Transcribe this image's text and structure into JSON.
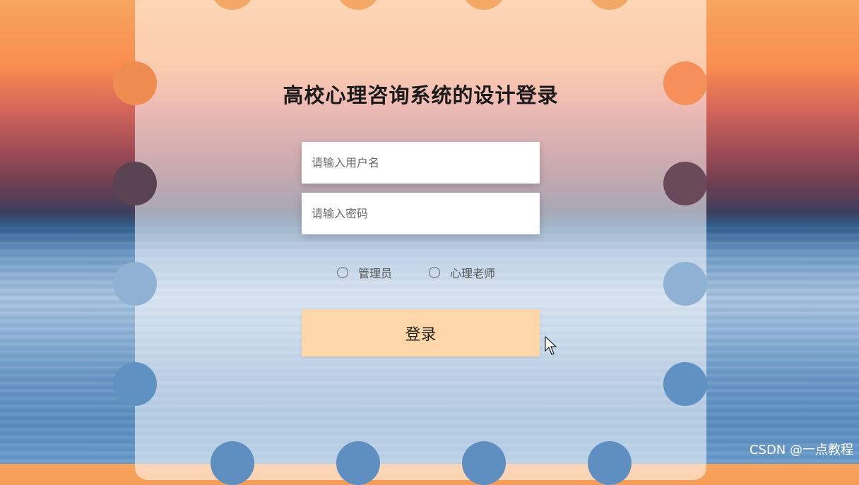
{
  "login": {
    "title": "高校心理咨询系统的设计登录",
    "username_placeholder": "请输入用户名",
    "password_placeholder": "请输入密码",
    "roles": [
      {
        "label": "管理员",
        "selected": false
      },
      {
        "label": "心理老师",
        "selected": false
      }
    ],
    "submit_label": "登录"
  },
  "watermark": "CSDN @一点教程",
  "colors": {
    "button_bg": "#fdd6a9",
    "card_overlay": "rgba(255,255,255,0.55)"
  }
}
